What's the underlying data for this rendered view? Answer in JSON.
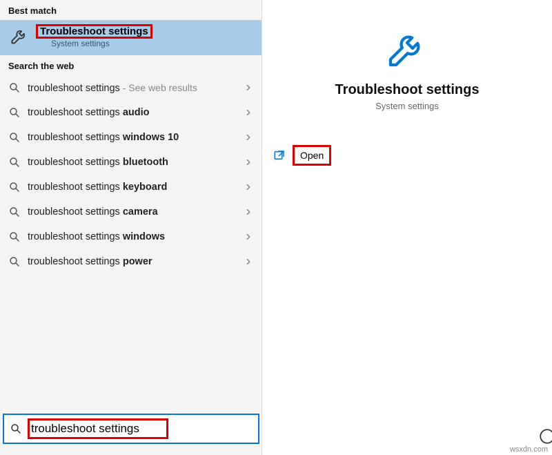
{
  "left": {
    "section_best": "Best match",
    "best_match": {
      "title": "Troubleshoot settings",
      "subtitle": "System settings"
    },
    "section_web": "Search the web",
    "web_items": [
      {
        "prefix": "troubleshoot settings",
        "suffix": "",
        "extra": " - See web results"
      },
      {
        "prefix": "troubleshoot settings ",
        "suffix": "audio",
        "extra": ""
      },
      {
        "prefix": "troubleshoot settings ",
        "suffix": "windows 10",
        "extra": ""
      },
      {
        "prefix": "troubleshoot settings ",
        "suffix": "bluetooth",
        "extra": ""
      },
      {
        "prefix": "troubleshoot settings ",
        "suffix": "keyboard",
        "extra": ""
      },
      {
        "prefix": "troubleshoot settings ",
        "suffix": "camera",
        "extra": ""
      },
      {
        "prefix": "troubleshoot settings ",
        "suffix": "windows",
        "extra": ""
      },
      {
        "prefix": "troubleshoot settings ",
        "suffix": "power",
        "extra": ""
      }
    ],
    "search_value": "troubleshoot settings"
  },
  "right": {
    "title": "Troubleshoot settings",
    "subtitle": "System settings",
    "open_label": "Open"
  },
  "watermark": "wsxdn.com",
  "colors": {
    "accent": "#0078d4",
    "highlight_red": "#d80000",
    "best_match_bg": "#a8cbe8"
  }
}
